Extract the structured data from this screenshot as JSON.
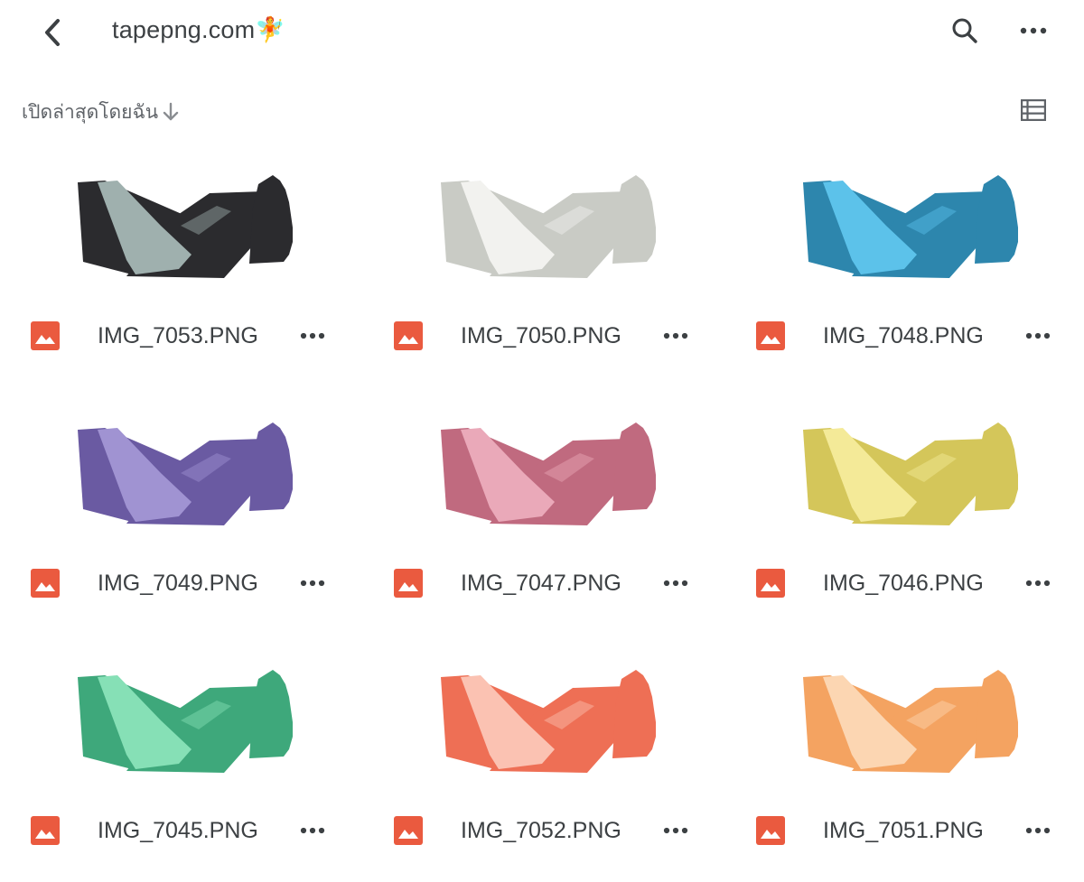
{
  "header": {
    "title": "tapepng.com",
    "title_emoji": "🧚",
    "back_icon": "chevron-left-icon",
    "search_icon": "search-icon",
    "more_icon": "more-horizontal-icon"
  },
  "sort": {
    "label": "เปิดล่าสุดโดยฉัน",
    "direction_icon": "arrow-down-icon",
    "view_toggle_icon": "list-view-icon"
  },
  "files": [
    {
      "name": "IMG_7053.PNG",
      "tape_color": "#2b2b2e",
      "fold_color": "#9fb0ae"
    },
    {
      "name": "IMG_7050.PNG",
      "tape_color": "#c9cbc5",
      "fold_color": "#f2f2ef"
    },
    {
      "name": "IMG_7048.PNG",
      "tape_color": "#2d86ad",
      "fold_color": "#5cc2ea"
    },
    {
      "name": "IMG_7049.PNG",
      "tape_color": "#6a5aa2",
      "fold_color": "#a093d2"
    },
    {
      "name": "IMG_7047.PNG",
      "tape_color": "#c06a7f",
      "fold_color": "#eaa9b9"
    },
    {
      "name": "IMG_7046.PNG",
      "tape_color": "#d4c65a",
      "fold_color": "#f4ea98"
    },
    {
      "name": "IMG_7045.PNG",
      "tape_color": "#3ea87b",
      "fold_color": "#86e0b6"
    },
    {
      "name": "IMG_7052.PNG",
      "tape_color": "#ee6f55",
      "fold_color": "#fbc2b2"
    },
    {
      "name": "IMG_7051.PNG",
      "tape_color": "#f4a361",
      "fold_color": "#fcd6b2"
    }
  ],
  "colors": {
    "image_icon": "#ea5a3f",
    "text": "#3c4043",
    "icon_gray": "#5f6368"
  }
}
